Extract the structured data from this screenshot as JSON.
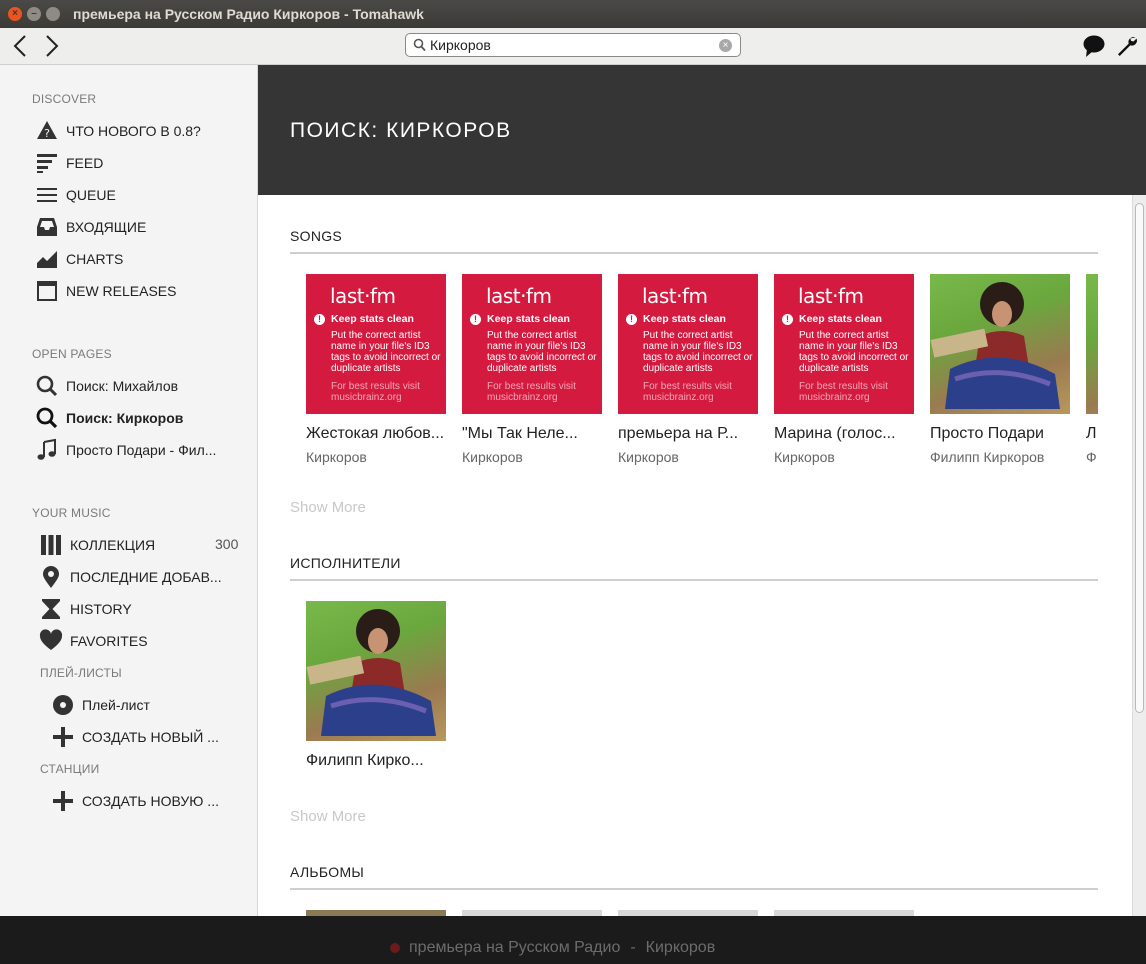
{
  "window": {
    "title": "премьера на Русском Радио Киркоров - Tomahawk"
  },
  "search": {
    "value": "Киркоров"
  },
  "sidebar": {
    "discover_title": "DISCOVER",
    "discover": [
      {
        "label": "ЧТО НОВОГО В 0.8?",
        "icon": "whats-new-icon"
      },
      {
        "label": "FEED",
        "icon": "feed-icon"
      },
      {
        "label": "QUEUE",
        "icon": "queue-icon"
      },
      {
        "label": "ВХОДЯЩИЕ",
        "icon": "inbox-icon"
      },
      {
        "label": "CHARTS",
        "icon": "charts-icon"
      },
      {
        "label": "NEW RELEASES",
        "icon": "new-releases-icon"
      }
    ],
    "open_pages_title": "OPEN PAGES",
    "open_pages": [
      {
        "label": "Поиск: Михайлов",
        "icon": "search-icon"
      },
      {
        "label": "Поиск: Киркоров",
        "icon": "search-icon",
        "active": true
      },
      {
        "label": "Просто Подари - Фил...",
        "icon": "music-note-icon"
      }
    ],
    "your_music_title": "YOUR MUSIC",
    "your_music": [
      {
        "label": "КОЛЛЕКЦИЯ",
        "count": "300",
        "icon": "collection-icon"
      },
      {
        "label": "ПОСЛЕДНИЕ ДОБАВ...",
        "icon": "location-pin-icon"
      },
      {
        "label": "HISTORY",
        "icon": "hourglass-icon"
      },
      {
        "label": "FAVORITES",
        "icon": "heart-icon"
      }
    ],
    "playlists_title": "ПЛЕЙ-ЛИСТЫ",
    "playlists": [
      {
        "label": "Плей-лист",
        "icon": "playlist-disc-icon"
      },
      {
        "label": "СОЗДАТЬ НОВЫЙ ...",
        "icon": "plus-icon"
      }
    ],
    "stations_title": "СТАНЦИИ",
    "stations": [
      {
        "label": "СОЗДАТЬ НОВУЮ ...",
        "icon": "plus-icon"
      }
    ]
  },
  "main": {
    "title": "ПОИСК: КИРКОРОВ",
    "songs_title": "SONGS",
    "artists_title": "ИСПОЛНИТЕЛИ",
    "albums_title": "АЛЬБОМЫ",
    "show_more": "Show More",
    "lastfm": {
      "logo": "last·fm",
      "heading": "Keep stats clean",
      "body": "Put the correct artist name in your file's ID3 tags to avoid incorrect or duplicate artists",
      "footer": "For best results visit musicbrainz.org"
    },
    "songs": [
      {
        "title": "Жестокая любов...",
        "artist": "Киркоров",
        "cover": "lastfm"
      },
      {
        "title": "\"Мы Так Неле...",
        "artist": "Киркоров",
        "cover": "lastfm"
      },
      {
        "title": "премьера на Р...",
        "artist": "Киркоров",
        "cover": "lastfm"
      },
      {
        "title": "Марина (голос...",
        "artist": "Киркоров",
        "cover": "lastfm"
      },
      {
        "title": "Просто Подари",
        "artist": "Филипп Киркоров",
        "cover": "photo"
      },
      {
        "title": "Л",
        "artist": "Ф",
        "cover": "photo"
      }
    ],
    "artists": [
      {
        "name": "Филипп Кирко..."
      }
    ]
  },
  "player": {
    "track": "премьера на Русском Радио",
    "separator": "-",
    "artist": "Киркоров"
  }
}
